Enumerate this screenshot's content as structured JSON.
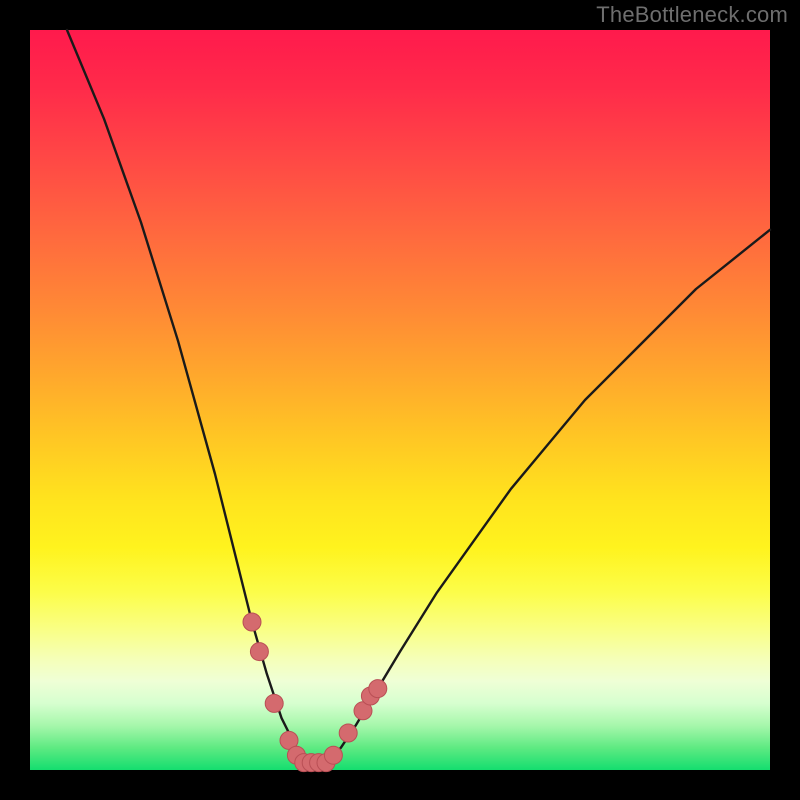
{
  "watermark": "TheBottleneck.com",
  "colors": {
    "curve_stroke": "#1a1a1a",
    "marker_fill": "#d46a6e",
    "marker_stroke": "#b94f55",
    "background": "#000000"
  },
  "chart_data": {
    "type": "line",
    "title": "",
    "xlabel": "",
    "ylabel": "",
    "xlim": [
      0,
      100
    ],
    "ylim": [
      0,
      100
    ],
    "legend": false,
    "grid": false,
    "notes": "Bottleneck-style heatmap background (red=top/bad → green=bottom/good) with a V-shaped bottleneck curve. No axis tick labels visible; y represents bottleneck %, x represents relative component strength. Minimum near x≈36–40.",
    "curve": [
      {
        "x": 5,
        "y": 100
      },
      {
        "x": 10,
        "y": 88
      },
      {
        "x": 15,
        "y": 74
      },
      {
        "x": 20,
        "y": 58
      },
      {
        "x": 25,
        "y": 40
      },
      {
        "x": 28,
        "y": 28
      },
      {
        "x": 30,
        "y": 20
      },
      {
        "x": 32,
        "y": 13
      },
      {
        "x": 34,
        "y": 7
      },
      {
        "x": 36,
        "y": 3
      },
      {
        "x": 38,
        "y": 1
      },
      {
        "x": 40,
        "y": 1
      },
      {
        "x": 42,
        "y": 3
      },
      {
        "x": 44,
        "y": 6
      },
      {
        "x": 47,
        "y": 11
      },
      {
        "x": 50,
        "y": 16
      },
      {
        "x": 55,
        "y": 24
      },
      {
        "x": 60,
        "y": 31
      },
      {
        "x": 65,
        "y": 38
      },
      {
        "x": 70,
        "y": 44
      },
      {
        "x": 75,
        "y": 50
      },
      {
        "x": 80,
        "y": 55
      },
      {
        "x": 85,
        "y": 60
      },
      {
        "x": 90,
        "y": 65
      },
      {
        "x": 95,
        "y": 69
      },
      {
        "x": 100,
        "y": 73
      }
    ],
    "markers": [
      {
        "x": 30,
        "y": 20
      },
      {
        "x": 31,
        "y": 16
      },
      {
        "x": 33,
        "y": 9
      },
      {
        "x": 35,
        "y": 4
      },
      {
        "x": 36,
        "y": 2
      },
      {
        "x": 37,
        "y": 1
      },
      {
        "x": 38,
        "y": 1
      },
      {
        "x": 39,
        "y": 1
      },
      {
        "x": 40,
        "y": 1
      },
      {
        "x": 41,
        "y": 2
      },
      {
        "x": 43,
        "y": 5
      },
      {
        "x": 45,
        "y": 8
      },
      {
        "x": 46,
        "y": 10
      },
      {
        "x": 47,
        "y": 11
      }
    ]
  }
}
